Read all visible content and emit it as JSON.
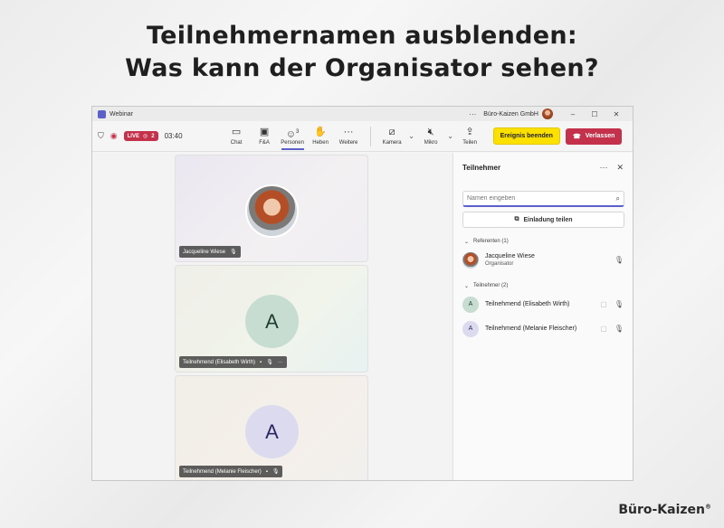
{
  "headline": {
    "line1": "Teilnehmernamen ausblenden:",
    "line2": "Was kann der Organisator sehen?"
  },
  "brand": {
    "name": "Büro-Kaizen",
    "mark": "®"
  },
  "window": {
    "title": "Webinar",
    "organization": "Büro-Kaizen GmbH",
    "controls": {
      "more": "···",
      "minimize": "–",
      "maximize": "☐",
      "close": "✕"
    }
  },
  "toolbar": {
    "live_label": "LIVE",
    "viewer_count": "2",
    "timer": "03:40",
    "items": {
      "chat": "Chat",
      "qa": "F&A",
      "people": "Personen",
      "people_count": "3",
      "raise": "Heben",
      "more": "Weitere",
      "camera": "Kamera",
      "mic": "Mikro",
      "share": "Teilen"
    },
    "end_event": "Ereignis beenden",
    "leave": "Verlassen"
  },
  "stage": {
    "tiles": [
      {
        "name": "Jacqueline Wiese"
      },
      {
        "initial": "A",
        "name": "Teilnehmend (Elisabeth Wirth)"
      },
      {
        "initial": "A",
        "name": "Teilnehmend (Melanie Fleischer)"
      }
    ]
  },
  "panel": {
    "title": "Teilnehmer",
    "search_placeholder": "Namen eingeben",
    "invite_label": "Einladung teilen",
    "presenters_heading": "Referenten (1)",
    "presenter": {
      "name": "Jacqueline Wiese",
      "role": "Organisator"
    },
    "attendees_heading": "Teilnehmer (2)",
    "attendees": [
      {
        "initial": "A",
        "name": "Teilnehmend (Elisabeth Wirth)"
      },
      {
        "initial": "A",
        "name": "Teilnehmend (Melanie Fleischer)"
      }
    ]
  },
  "colors": {
    "accent": "#5b5fc7",
    "live": "#c4314b",
    "end_button": "#fce100",
    "leave_button": "#c4314b"
  }
}
